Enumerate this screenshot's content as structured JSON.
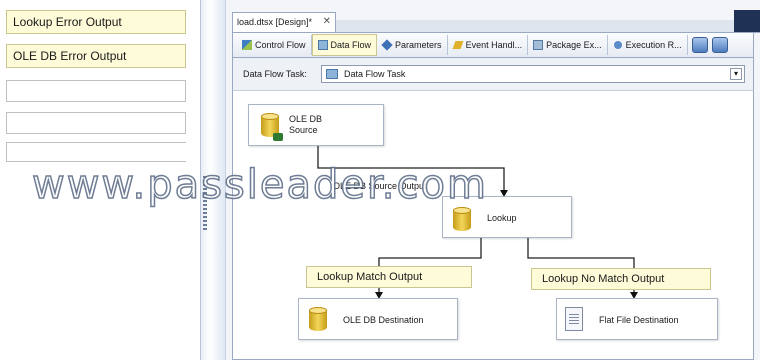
{
  "left_panel": {
    "outputs": [
      "Lookup Error Output",
      "OLE DB Error Output"
    ]
  },
  "document_tab": {
    "title": "load.dtsx [Design]*",
    "close": "✕"
  },
  "designer_tabs": [
    {
      "label": "Control Flow",
      "icon": "control-flow-icon"
    },
    {
      "label": "Data Flow",
      "icon": "data-flow-icon"
    },
    {
      "label": "Parameters",
      "icon": "parameters-icon"
    },
    {
      "label": "Event Handl...",
      "icon": "event-handlers-icon"
    },
    {
      "label": "Package Ex...",
      "icon": "package-explorer-icon"
    },
    {
      "label": "Execution R...",
      "icon": "execution-results-icon"
    }
  ],
  "active_tab": "Data Flow",
  "task_bar": {
    "label": "Data Flow Task:",
    "value": "Data Flow Task",
    "dropdown_arrow": "▾"
  },
  "components": {
    "source": {
      "line1": "OLE DB",
      "line2": "Source"
    },
    "lookup": {
      "label": "Lookup"
    },
    "oledb_dest": {
      "label": "OLE DB Destination"
    },
    "flat_dest": {
      "label": "Flat File Destination"
    }
  },
  "paths": {
    "source_output": "OLE DB Source Output",
    "match": "Lookup Match Output",
    "no_match": "Lookup No Match Output"
  },
  "watermark": "www.passleader.com",
  "colors": {
    "annotation_bg": "#fdfbd8",
    "tab_border": "#9aa9c2",
    "dark_strip": "#1f3154"
  }
}
